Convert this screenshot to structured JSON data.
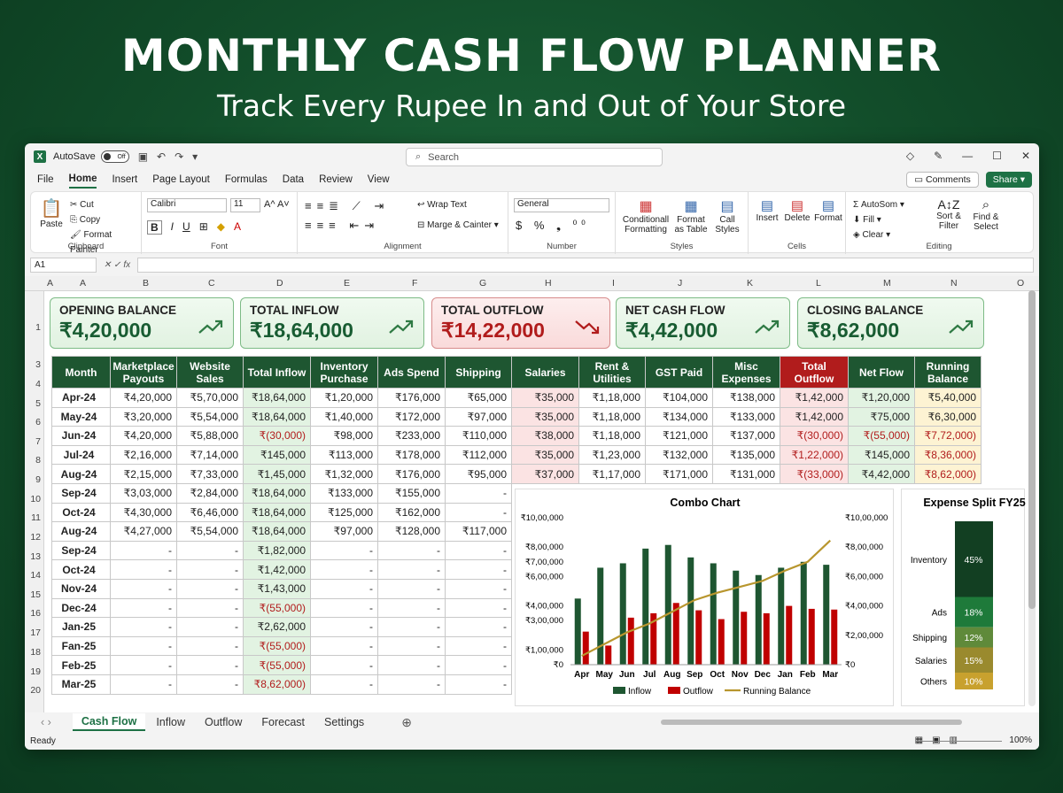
{
  "hero": {
    "title": "MONTHLY CASH FLOW PLANNER",
    "subtitle": "Track Every Rupee In and Out of Your Store"
  },
  "titlebar": {
    "autosave": "AutoSave",
    "toggle": "Off",
    "search_placeholder": "Search"
  },
  "menu": [
    "File",
    "Home",
    "Insert",
    "Page Layout",
    "Formulas",
    "Data",
    "Review",
    "View"
  ],
  "menu_right": {
    "comments": "Comments",
    "share": "Share"
  },
  "ribbon": {
    "clipboard": {
      "paste": "Paste",
      "cut": "Cut",
      "copy": "Copy",
      "format_painter": "Format Painter",
      "label": "Clipboard"
    },
    "font": {
      "name": "Calibri",
      "size": "11",
      "label": "Font"
    },
    "alignment": {
      "wrap": "Wrap Text",
      "merge": "Marge & Cainter",
      "label": "Alignment"
    },
    "number": {
      "format": "General",
      "label": "Number"
    },
    "styles": {
      "cond": "Conditionall Formatting",
      "table": "Format as Table",
      "cell": "Call Styles",
      "label": "Styles"
    },
    "cells": {
      "insert": "Insert",
      "delete": "Delete",
      "format": "Format",
      "label": "Cells"
    },
    "editing": {
      "autosum": "AutoSom",
      "fill": "Fill",
      "clear": "Clear",
      "sort": "Sort & Filter",
      "find": "Find & Select",
      "label": "Editing"
    }
  },
  "namebox": "A1",
  "columns": [
    "A",
    "A",
    "B",
    "C",
    "D",
    "E",
    "F",
    "G",
    "H",
    "I",
    "J",
    "K",
    "L",
    "M",
    "N",
    "O"
  ],
  "rows": [
    "1",
    "3",
    "4",
    "5",
    "6",
    "7",
    "8",
    "9",
    "10",
    "11",
    "12",
    "13",
    "14",
    "15",
    "16",
    "17",
    "18",
    "19",
    "20"
  ],
  "kpis": [
    {
      "label": "OPENING BALANCE",
      "value": "₹4,20,000",
      "type": "green"
    },
    {
      "label": "TOTAL INFLOW",
      "value": "₹18,64,000",
      "type": "green"
    },
    {
      "label": "TOTAL OUTFLOW",
      "value": "₹14,22,000",
      "type": "red"
    },
    {
      "label": "NET CASH FLOW",
      "value": "₹4,42,000",
      "type": "green"
    },
    {
      "label": "CLOSING BALANCE",
      "value": "₹8,62,000",
      "type": "green"
    }
  ],
  "table": {
    "headers": [
      "Month",
      "Marketplace Payouts",
      "Website Sales",
      "Total Inflow",
      "Inventory Purchase",
      "Ads Spend",
      "Shipping",
      "Salaries",
      "Rent & Utilities",
      "GST Paid",
      "Misc Expenses",
      "Total Outflow",
      "Net Flow",
      "Running Balance"
    ],
    "rows": [
      [
        "Apr-24",
        "₹4,20,000",
        "₹5,70,000",
        "₹18,64,000",
        "₹1,20,000",
        "₹176,000",
        "₹65,000",
        "₹35,000",
        "₹1,18,000",
        "₹104,000",
        "₹138,000",
        "₹1,42,000",
        "₹1,20,000",
        "₹5,40,000"
      ],
      [
        "May-24",
        "₹3,20,000",
        "₹5,54,000",
        "₹18,64,000",
        "₹1,40,000",
        "₹172,000",
        "₹97,000",
        "₹35,000",
        "₹1,18,000",
        "₹134,000",
        "₹133,000",
        "₹1,42,000",
        "₹75,000",
        "₹6,30,000"
      ],
      [
        "Jun-24",
        "₹4,20,000",
        "₹5,88,000",
        "₹(30,000)",
        "₹98,000",
        "₹233,000",
        "₹110,000",
        "₹38,000",
        "₹1,18,000",
        "₹121,000",
        "₹137,000",
        "₹(30,000)",
        "₹(55,000)",
        "₹7,72,000)"
      ],
      [
        "Jul-24",
        "₹2,16,000",
        "₹7,14,000",
        "₹145,000",
        "₹113,000",
        "₹178,000",
        "₹112,000",
        "₹35,000",
        "₹1,23,000",
        "₹132,000",
        "₹135,000",
        "₹1,22,000)",
        "₹145,000",
        "₹8,36,000)"
      ],
      [
        "Aug-24",
        "₹2,15,000",
        "₹7,33,000",
        "₹1,45,000",
        "₹1,32,000",
        "₹176,000",
        "₹95,000",
        "₹37,000",
        "₹1,17,000",
        "₹171,000",
        "₹131,000",
        "₹(33,000)",
        "₹4,42,000",
        "₹8,62,000)"
      ],
      [
        "Sep-24",
        "₹3,03,000",
        "₹2,84,000",
        "₹18,64,000",
        "₹133,000",
        "₹155,000",
        "-"
      ],
      [
        "Oct-24",
        "₹4,30,000",
        "₹6,46,000",
        "₹18,64,000",
        "₹125,000",
        "₹162,000",
        "-"
      ],
      [
        "Aug-24",
        "₹4,27,000",
        "₹5,54,000",
        "₹18,64,000",
        "₹97,000",
        "₹128,000",
        "₹117,000"
      ],
      [
        "Sep-24",
        "-",
        "-",
        "₹1,82,000",
        "-",
        "-",
        "-"
      ],
      [
        "Oct-24",
        "-",
        "-",
        "₹1,42,000",
        "-",
        "-",
        "-"
      ],
      [
        "Nov-24",
        "-",
        "-",
        "₹1,43,000",
        "-",
        "-",
        "-"
      ],
      [
        "Dec-24",
        "-",
        "-",
        "₹(55,000)",
        "-",
        "-",
        "-"
      ],
      [
        "Jan-25",
        "-",
        "-",
        "₹2,62,000",
        "-",
        "-",
        "-"
      ],
      [
        "Fan-25",
        "-",
        "-",
        "₹(55,000)",
        "-",
        "-",
        "-"
      ],
      [
        "Feb-25",
        "-",
        "-",
        "₹(55,000)",
        "-",
        "-",
        "-"
      ],
      [
        "Mar-25",
        "-",
        "-",
        "₹8,62,000)",
        "-",
        "-",
        "-"
      ]
    ]
  },
  "chart_data": [
    {
      "type": "bar",
      "title": "Combo Chart",
      "categories": [
        "Apr",
        "May",
        "Jun",
        "Jul",
        "Aug",
        "Sep",
        "Oct",
        "Nov",
        "Dec",
        "Jan",
        "Feb",
        "Mar"
      ],
      "series": [
        {
          "name": "Inflow",
          "kind": "bar",
          "color": "#1e5631",
          "values": [
            450000,
            660000,
            690000,
            790000,
            815000,
            730000,
            690000,
            640000,
            610000,
            660000,
            700000,
            680000
          ]
        },
        {
          "name": "Outflow",
          "kind": "bar",
          "color": "#c00000",
          "values": [
            225000,
            130000,
            320000,
            350000,
            420000,
            370000,
            310000,
            360000,
            350000,
            400000,
            380000,
            375000
          ]
        },
        {
          "name": "Running Balance",
          "kind": "line",
          "color": "#b8962e",
          "values": [
            60000,
            140000,
            220000,
            280000,
            360000,
            440000,
            490000,
            530000,
            570000,
            640000,
            700000,
            845000
          ]
        }
      ],
      "y_left_ticks": [
        "₹0",
        "₹1,00,000",
        "₹3,00,000",
        "₹4,00,000",
        "₹6,00,000",
        "₹7,00,000",
        "₹8,00,000",
        "₹10,00,000"
      ],
      "y_right_ticks": [
        "₹0",
        "₹2,00,000",
        "₹4,00,000",
        "₹6,00,000",
        "₹8,00,000",
        "₹10,00,000"
      ],
      "ylim": [
        0,
        1000000
      ],
      "legend": "bottom"
    },
    {
      "type": "bar",
      "title": "Expense Split FY25",
      "categories": [
        "Inventory",
        "Ads",
        "Shipping",
        "Salaries",
        "Others"
      ],
      "values": [
        45,
        18,
        12,
        15,
        10
      ],
      "value_labels": [
        "45%",
        "18%",
        "12%",
        "15%",
        "10%"
      ],
      "colors": [
        "#123f22",
        "#1e7a3a",
        "#5f8a3a",
        "#9a8a2e",
        "#c8a12e"
      ]
    }
  ],
  "sheet_tabs": [
    "Cash Flow",
    "Inflow",
    "Outflow",
    "Forecast",
    "Settings"
  ],
  "status": {
    "left": "Ready",
    "zoom": "100%"
  }
}
